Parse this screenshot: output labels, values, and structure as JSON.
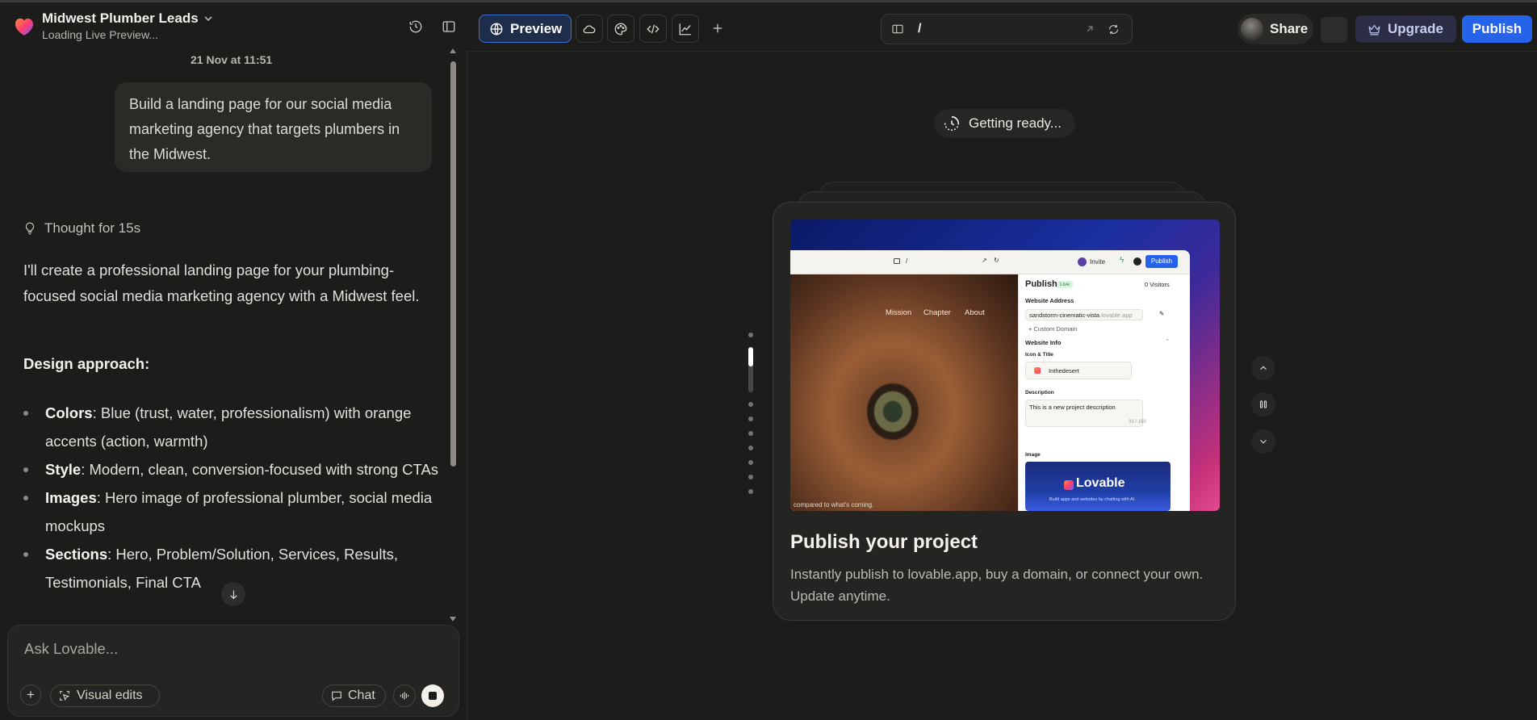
{
  "project": {
    "title": "Midwest Plumber Leads",
    "status": "Loading Live Preview..."
  },
  "toolbar": {
    "preview_label": "Preview",
    "url_path": "/",
    "share_label": "Share",
    "upgrade_label": "Upgrade",
    "publish_label": "Publish"
  },
  "chat": {
    "date": "21 Nov at 11:51",
    "user_message": "Build a landing page for our social media marketing agency that targets plumbers in the Midwest.",
    "thought": "Thought for 15s",
    "answer_intro": "I'll create a professional landing page for your plumbing-focused social media marketing agency with a Midwest feel.",
    "design_heading": "Design approach:",
    "bullets": [
      {
        "label": "Colors",
        "text": ": Blue (trust, water, professionalism) with orange accents (action, warmth)"
      },
      {
        "label": "Style",
        "text": ": Modern, clean, conversion-focused with strong CTAs"
      },
      {
        "label": "Images",
        "text": ": Hero image of professional plumber, social media mockups"
      },
      {
        "label": "Sections",
        "text": ": Hero, Problem/Solution, Services, Results, Testimonials, Final CTA"
      }
    ]
  },
  "composer": {
    "placeholder": "Ask Lovable...",
    "visual_edits_label": "Visual edits",
    "chat_label": "Chat"
  },
  "preview": {
    "status": "Getting ready...",
    "card_title": "Publish your project",
    "card_desc": "Instantly publish to lovable.app, buy a domain, or connect your own. Update anytime.",
    "slide_count": 9,
    "active_slide": 2,
    "mock": {
      "path": "/",
      "invite": "Invite",
      "publish": "Publish",
      "nav": [
        "Mission",
        "Chapter",
        "About"
      ],
      "caption": "compared to what's coming.",
      "panel_title": "Publish",
      "live_badge": "Live",
      "visitors": "0 Visitors",
      "website_address": "Website Address",
      "domain": "sandstorm-cinematic-vista",
      "domain_suffix": ".lovable.app",
      "custom_domain": "Custom Domain",
      "website_info": "Website Info",
      "icon_title": "Icon & Title",
      "site_name": "Inthedesert",
      "description_label": "Description",
      "description_value": "This is a new project description",
      "char_count": "33 / 160",
      "image_label": "Image",
      "brand": "Lovable",
      "brand_tagline": "Build apps and websites by chatting with AI"
    }
  },
  "colors": {
    "accent": "#2563eb",
    "preview_border": "#3b6fd3",
    "upgrade_bg": "#2b2e45"
  }
}
